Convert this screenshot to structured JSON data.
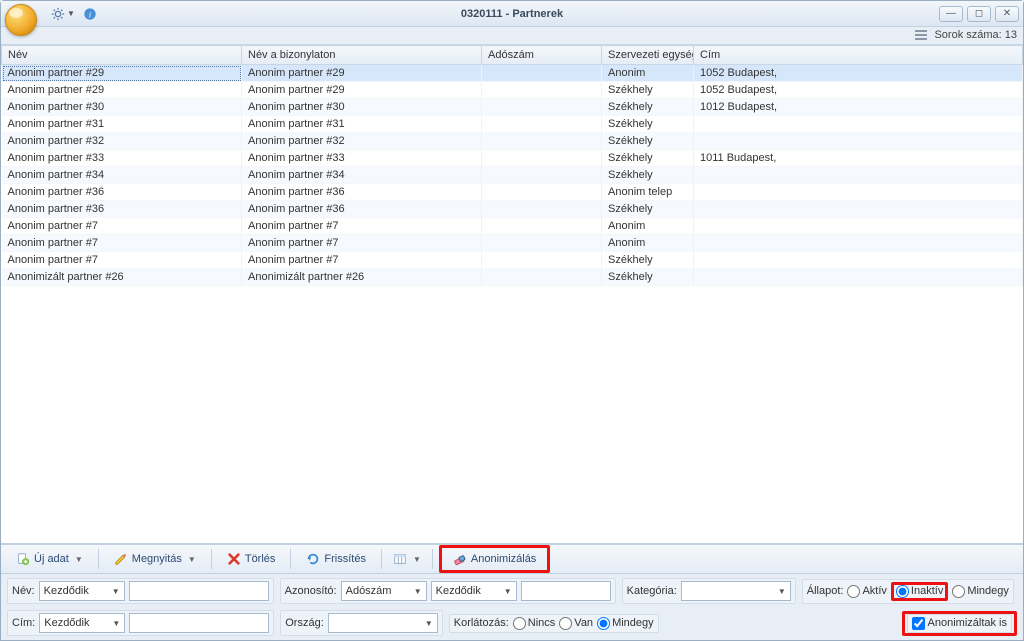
{
  "window": {
    "title": "0320111 - Partnerek"
  },
  "rowcount": {
    "label": "Sorok száma: 13"
  },
  "columns": {
    "nev": "Név",
    "bizon": "Név a bizonylaton",
    "ado": "Adószám",
    "szerv": "Szervezeti egység",
    "cim": "Cím"
  },
  "rows": [
    {
      "nev": "Anonim partner #29",
      "bizon": "Anonim partner #29",
      "ado": "",
      "szerv": "Anonim",
      "cim": "1052 Budapest,",
      "selected": true
    },
    {
      "nev": "Anonim partner #29",
      "bizon": "Anonim partner #29",
      "ado": "",
      "szerv": "Székhely",
      "cim": "1052 Budapest,"
    },
    {
      "nev": "Anonim partner #30",
      "bizon": "Anonim partner #30",
      "ado": "",
      "szerv": "Székhely",
      "cim": "1012 Budapest,"
    },
    {
      "nev": "Anonim partner #31",
      "bizon": "Anonim partner #31",
      "ado": "",
      "szerv": "Székhely",
      "cim": ""
    },
    {
      "nev": "Anonim partner #32",
      "bizon": "Anonim partner #32",
      "ado": "",
      "szerv": "Székhely",
      "cim": ""
    },
    {
      "nev": "Anonim partner #33",
      "bizon": "Anonim partner #33",
      "ado": "",
      "szerv": "Székhely",
      "cim": "1011 Budapest,"
    },
    {
      "nev": "Anonim partner #34",
      "bizon": "Anonim partner #34",
      "ado": "",
      "szerv": "Székhely",
      "cim": ""
    },
    {
      "nev": "Anonim partner #36",
      "bizon": "Anonim partner #36",
      "ado": "",
      "szerv": "Anonim telep",
      "cim": ""
    },
    {
      "nev": "Anonim partner #36",
      "bizon": "Anonim partner #36",
      "ado": "",
      "szerv": "Székhely",
      "cim": ""
    },
    {
      "nev": "Anonim partner #7",
      "bizon": "Anonim partner #7",
      "ado": "",
      "szerv": "Anonim",
      "cim": ""
    },
    {
      "nev": "Anonim partner #7",
      "bizon": "Anonim partner #7",
      "ado": "",
      "szerv": "Anonim",
      "cim": ""
    },
    {
      "nev": "Anonim partner #7",
      "bizon": "Anonim partner #7",
      "ado": "",
      "szerv": "Székhely",
      "cim": ""
    },
    {
      "nev": "Anonimizált partner #26",
      "bizon": "Anonimizált partner #26",
      "ado": "",
      "szerv": "Székhely",
      "cim": ""
    }
  ],
  "toolbar": {
    "ujadat": "Új adat",
    "megnyitas": "Megnyitás",
    "torles": "Törlés",
    "frissites": "Frissítés",
    "anonimizalas": "Anonimizálás"
  },
  "filters": {
    "nev_label": "Név:",
    "kezdodik": "Kezdődik",
    "azonosito_label": "Azonosító:",
    "adoszam": "Adószám",
    "kategoria_label": "Kategória:",
    "allapot_label": "Állapot:",
    "aktiv": "Aktív",
    "inaktiv": "Inaktív",
    "mindegy": "Mindegy",
    "cim_label": "Cím:",
    "orszag_label": "Ország:",
    "korlatozas_label": "Korlátozás:",
    "nincs": "Nincs",
    "van": "Van",
    "anonimizaltak_is": "Anonimizáltak is"
  }
}
